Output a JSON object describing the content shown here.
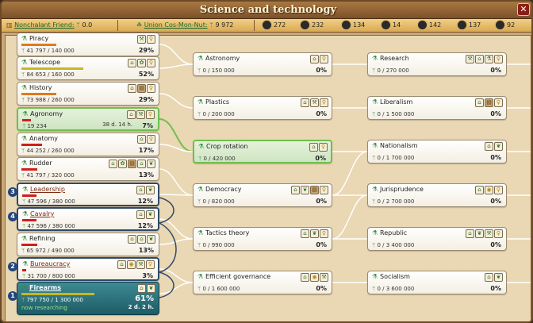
{
  "window": {
    "title": "Science and technology"
  },
  "status": {
    "friend_label": "Nonchalant Friend:",
    "friend_value": "0.0",
    "union_label": "Union Cos-Mon-Nut:",
    "union_value": "9 972",
    "resources": [
      "272",
      "232",
      "134",
      "14",
      "142",
      "137",
      "92"
    ]
  },
  "left": [
    {
      "name": "Piracy",
      "sci": "41 797 / 140 000",
      "pct": "29%",
      "icons": [
        "hammer-icon",
        "bulb-icon"
      ],
      "bar": 0.29,
      "bar_color": "orange"
    },
    {
      "name": "Telescope",
      "sci": "84 653 / 160 000",
      "pct": "52%",
      "icons": [
        "house-icon",
        "gear-icon",
        "bulb-icon"
      ],
      "bar": 0.52,
      "bar_color": "yellow"
    },
    {
      "name": "History",
      "sci": "73 988 / 260 000",
      "pct": "29%",
      "icons": [
        "house-icon",
        "book-icon",
        "bulb-icon"
      ],
      "bar": 0.29,
      "bar_color": "orange"
    },
    {
      "name": "Agronomy",
      "sci": "19 234",
      "eta": "38 d. 14 h.",
      "pct": "7%",
      "icons": [
        "house-icon",
        "hammer-icon",
        "bulb-icon"
      ],
      "bar": 0.07,
      "bar_color": "red"
    },
    {
      "name": "Anatomy",
      "sci": "44 252 / 260 000",
      "pct": "17%",
      "icons": [
        "house-icon",
        "bulb-icon"
      ],
      "bar": 0.17,
      "bar_color": "red"
    },
    {
      "name": "Rudder",
      "sci": "41 797 / 320 000",
      "pct": "13%",
      "icons": [
        "house-icon",
        "gear-icon",
        "book-icon",
        "house-icon",
        "leaf-icon"
      ],
      "bar": 0.13,
      "bar_color": "red"
    },
    {
      "name": "Leadership",
      "sci": "47 596 / 380 000",
      "pct": "12%",
      "icons": [
        "house-icon",
        "leaf-icon"
      ],
      "bar": 0.12,
      "bar_color": "red"
    },
    {
      "name": "Cavalry",
      "sci": "47 596 / 380 000",
      "pct": "12%",
      "icons": [
        "house-icon",
        "leaf-icon"
      ],
      "bar": 0.12,
      "bar_color": "red"
    },
    {
      "name": "Refining",
      "sci": "65 972 / 490 000",
      "pct": "13%",
      "icons": [
        "house-icon",
        "house-icon",
        "leaf-icon"
      ],
      "bar": 0.13,
      "bar_color": "red"
    },
    {
      "name": "Bureaucracy",
      "sci": "31 700 / 800 000",
      "pct": "3%",
      "icons": [
        "house-icon",
        "coin-icon",
        "hammer-icon",
        "bulb-icon"
      ],
      "bar": 0.03,
      "bar_color": "red"
    },
    {
      "name": "Firearms",
      "sci": "797 750 / 1 300 000",
      "pct": "61%",
      "eta": "2 d. 2 h.",
      "note": "now researching",
      "icons": [
        "house-icon",
        "leaf-icon"
      ],
      "bar": 0.61,
      "bar_color": "yellow"
    }
  ],
  "badges": [
    "3",
    "4",
    "2",
    "1"
  ],
  "mid": [
    {
      "name": "Astronomy",
      "sci": "0 / 150 000",
      "pct": "0%",
      "icons": [
        "house-icon",
        "bulb-icon"
      ]
    },
    {
      "name": "Plastics",
      "sci": "0 / 200 000",
      "pct": "0%",
      "icons": [
        "house-icon",
        "hammer-icon",
        "bulb-icon"
      ]
    },
    {
      "name": "Crop rotation",
      "sci": "0 / 420 000",
      "pct": "0%",
      "icons": [
        "house-icon",
        "bulb-icon"
      ]
    },
    {
      "name": "Democracy",
      "sci": "0 / 820 000",
      "pct": "0%",
      "icons": [
        "house-icon",
        "leaf-icon",
        "book-icon",
        "bulb-icon"
      ]
    },
    {
      "name": "Tactics theory",
      "sci": "0 / 990 000",
      "pct": "0%",
      "icons": [
        "house-icon",
        "leaf-icon",
        "bulb-icon"
      ]
    },
    {
      "name": "Efficient governance",
      "sci": "0 / 1 600 000",
      "pct": "0%",
      "icons": [
        "house-icon",
        "coin-icon",
        "hammer-icon"
      ]
    }
  ],
  "right": [
    {
      "name": "Research",
      "sci": "0 / 270 000",
      "pct": "0%",
      "icons": [
        "hammer-icon",
        "house-icon",
        "flask-icon",
        "bulb-icon"
      ]
    },
    {
      "name": "Liberalism",
      "sci": "0 / 1 500 000",
      "pct": "0%",
      "icons": [
        "house-icon",
        "book-icon",
        "bulb-icon"
      ]
    },
    {
      "name": "Nationalism",
      "sci": "0 / 1 700 000",
      "pct": "0%",
      "icons": [
        "house-icon",
        "leaf-icon"
      ]
    },
    {
      "name": "Jurisprudence",
      "sci": "0 / 2 700 000",
      "pct": "0%",
      "icons": [
        "house-icon",
        "coin-icon",
        "bulb-icon"
      ]
    },
    {
      "name": "Republic",
      "sci": "0 / 3 400 000",
      "pct": "0%",
      "icons": [
        "house-icon",
        "leaf-icon",
        "hammer-icon",
        "bulb-icon"
      ]
    },
    {
      "name": "Socialism",
      "sci": "0 / 3 600 000",
      "pct": "0%",
      "icons": [
        "house-icon",
        "leaf-icon"
      ]
    }
  ],
  "icon_glyphs": {
    "hammer-icon": "⚒",
    "bulb-icon": "♀",
    "house-icon": "⌂",
    "gear-icon": "✿",
    "book-icon": "▤",
    "leaf-icon": "❦",
    "coin-icon": "◉",
    "flask-icon": "⚗"
  }
}
